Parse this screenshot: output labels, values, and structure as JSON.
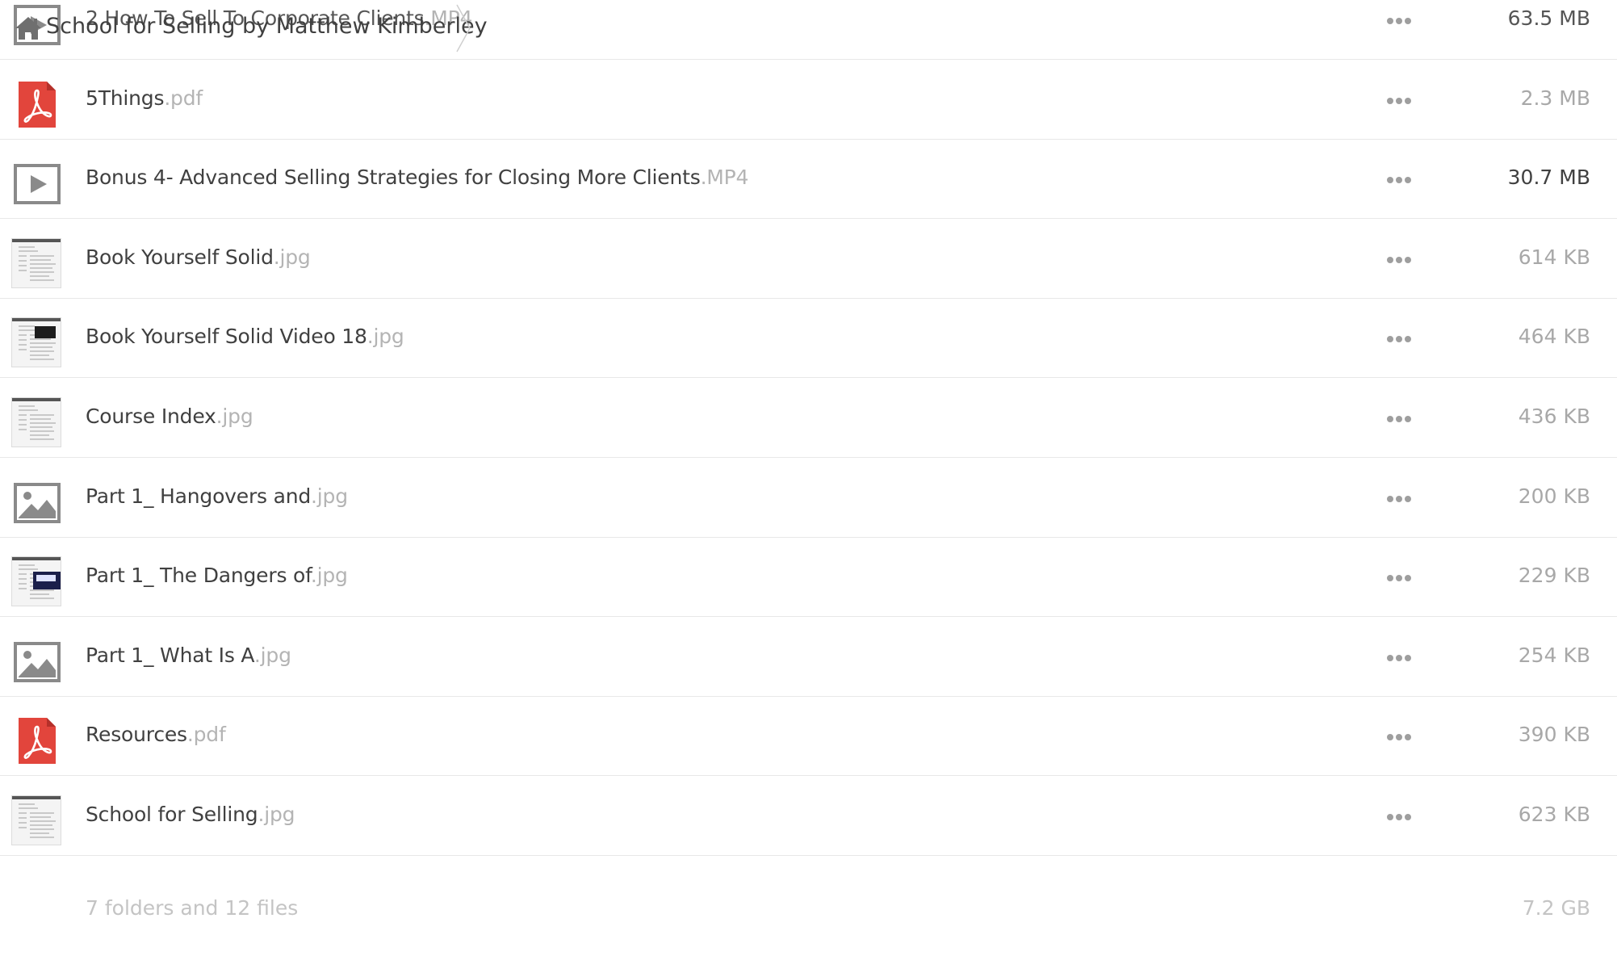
{
  "breadcrumb": {
    "title": "School for Selling by Matthew Kimberley",
    "home_icon": "home-icon"
  },
  "files": [
    {
      "base": "2 How To Sell To Corporate Clients",
      "ext": ".MP4",
      "size": "63.5 MB",
      "icon": "video-icon",
      "size_dark": true,
      "partial": true
    },
    {
      "base": "5Things",
      "ext": ".pdf",
      "size": "2.3 MB",
      "icon": "pdf-icon",
      "size_dark": false
    },
    {
      "base": "Bonus 4- Advanced Selling Strategies for Closing More Clients",
      "ext": ".MP4",
      "size": "30.7 MB",
      "icon": "video-icon",
      "size_dark": true
    },
    {
      "base": "Book Yourself Solid",
      "ext": ".jpg",
      "size": "614 KB",
      "icon": "document-thumbnail",
      "size_dark": false
    },
    {
      "base": "Book Yourself Solid Video 18",
      "ext": ".jpg",
      "size": "464 KB",
      "icon": "document-thumbnail-video",
      "size_dark": false
    },
    {
      "base": "Course Index",
      "ext": ".jpg",
      "size": "436 KB",
      "icon": "document-thumbnail",
      "size_dark": false
    },
    {
      "base": "Part 1_ Hangovers and",
      "ext": ".jpg",
      "size": "200 KB",
      "icon": "image-icon",
      "size_dark": false
    },
    {
      "base": "Part 1_ The Dangers of",
      "ext": ".jpg",
      "size": "229 KB",
      "icon": "document-thumbnail-dark",
      "size_dark": false
    },
    {
      "base": "Part 1_ What Is A",
      "ext": ".jpg",
      "size": "254 KB",
      "icon": "image-icon",
      "size_dark": false
    },
    {
      "base": "Resources",
      "ext": ".pdf",
      "size": "390 KB",
      "icon": "pdf-icon",
      "size_dark": false
    },
    {
      "base": "School for Selling",
      "ext": ".jpg",
      "size": "623 KB",
      "icon": "document-thumbnail",
      "size_dark": false
    }
  ],
  "more_icon": "more-options-icon",
  "footer": {
    "summary": "7 folders and 12 files",
    "total_size": "7.2 GB"
  },
  "colors": {
    "pdf_red": "#e2453c",
    "icon_gray": "#8a8a8a",
    "text": "#404040",
    "ext_gray": "#b4b4b4"
  }
}
